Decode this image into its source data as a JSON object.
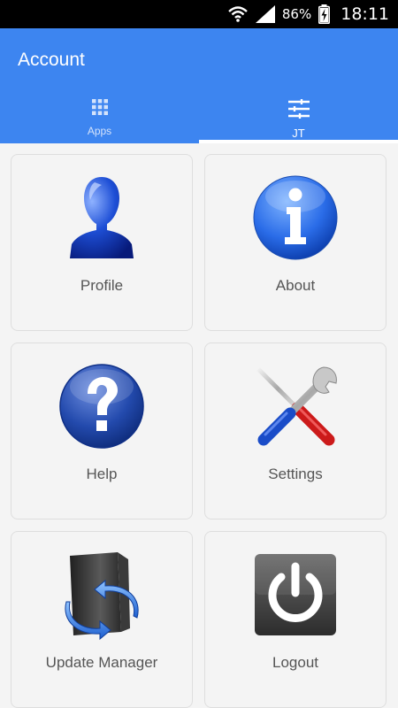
{
  "status_bar": {
    "battery_percent": "86%",
    "time": "18:11",
    "icons": [
      "wifi-icon",
      "signal-icon",
      "battery-charging-icon"
    ]
  },
  "app_bar": {
    "title": "Account",
    "background_color": "#3d85f0"
  },
  "tabs": [
    {
      "label": "Apps",
      "icon": "grid-icon",
      "active": false
    },
    {
      "label": "JT",
      "icon": "sliders-icon",
      "active": true
    }
  ],
  "tiles": [
    {
      "label": "Profile",
      "icon": "user-icon"
    },
    {
      "label": "About",
      "icon": "info-icon"
    },
    {
      "label": "Help",
      "icon": "help-icon"
    },
    {
      "label": "Settings",
      "icon": "tools-icon"
    },
    {
      "label": "Update Manager",
      "icon": "update-icon"
    },
    {
      "label": "Logout",
      "icon": "power-icon"
    }
  ]
}
